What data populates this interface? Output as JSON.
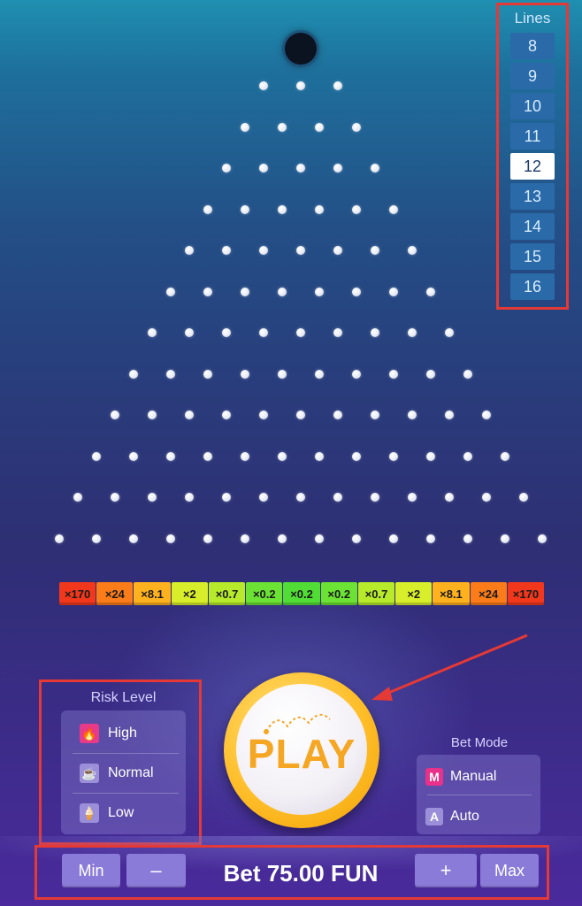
{
  "lines": {
    "title": "Lines",
    "options": [
      "8",
      "9",
      "10",
      "11",
      "12",
      "13",
      "14",
      "15",
      "16"
    ],
    "selected": "12"
  },
  "board": {
    "rows": 12
  },
  "multipliers": [
    {
      "label": "×170",
      "color": "#f2381c"
    },
    {
      "label": "×24",
      "color": "#fb7c18"
    },
    {
      "label": "×8.1",
      "color": "#ffb11e"
    },
    {
      "label": "×2",
      "color": "#d8ee2a"
    },
    {
      "label": "×0.7",
      "color": "#b6ea2b"
    },
    {
      "label": "×0.2",
      "color": "#6ce234"
    },
    {
      "label": "×0.2",
      "color": "#52dc36"
    },
    {
      "label": "×0.2",
      "color": "#6ce234"
    },
    {
      "label": "×0.7",
      "color": "#b6ea2b"
    },
    {
      "label": "×2",
      "color": "#d8ee2a"
    },
    {
      "label": "×8.1",
      "color": "#ffb11e"
    },
    {
      "label": "×24",
      "color": "#fb7c18"
    },
    {
      "label": "×170",
      "color": "#f2381c"
    }
  ],
  "risk": {
    "title": "Risk Level",
    "high": {
      "label": "High",
      "icon": "flame-icon",
      "icon_char": "🔥",
      "icon_color": "#e83a8a"
    },
    "normal": {
      "label": "Normal",
      "icon": "coffee-cup-icon",
      "icon_char": "☕",
      "icon_color": "#9a8fd8"
    },
    "low": {
      "label": "Low",
      "icon": "ice-cream-icon",
      "icon_char": "🍦",
      "icon_color": "#9a8fd8"
    }
  },
  "play": {
    "label": "PLAY"
  },
  "bet_mode": {
    "title": "Bet Mode",
    "manual": {
      "label": "Manual",
      "badge": "M",
      "color": "#e8318a"
    },
    "auto": {
      "label": "Auto",
      "badge": "A",
      "color": "#9a8fd8"
    }
  },
  "bet": {
    "min_label": "Min",
    "minus_label": "–",
    "bet_text": "Bet 75.00 FUN",
    "plus_label": "+",
    "max_label": "Max"
  },
  "annotation_color": "#e53935"
}
